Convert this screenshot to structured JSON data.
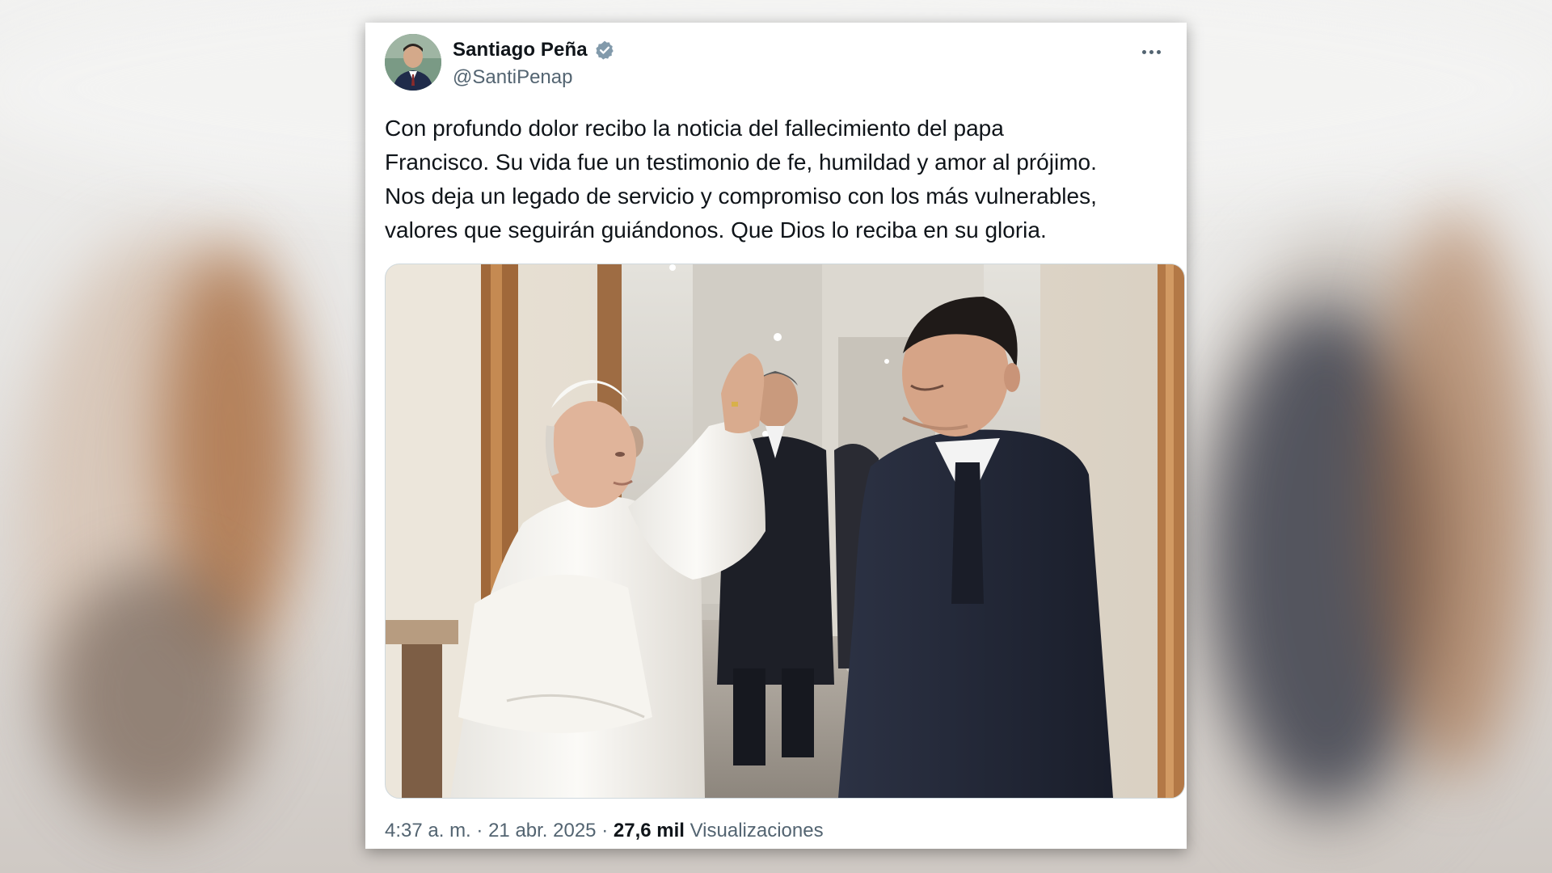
{
  "tweet": {
    "author": {
      "name": "Santiago Peña",
      "handle": "@SantiPenap",
      "verified": true
    },
    "text_lines": [
      "Con profundo dolor recibo la noticia del fallecimiento del papa",
      "Francisco. Su vida fue un testimonio de fe, humildad y amor al prójimo.",
      "Nos deja un legado de servicio y compromiso con los más vulnerables,",
      "valores que seguirán guiándonos. Que Dios lo reciba en su gloria."
    ],
    "meta": {
      "time": "4:37 a. m.",
      "separator": "·",
      "date": "21 abr. 2025",
      "views_count": "27,6 mil",
      "views_label": "Visualizaciones"
    }
  },
  "icons": {
    "verified": "verified-badge-icon",
    "more": "more-options-icon"
  },
  "colors": {
    "verified_badge": "#829aab",
    "text_primary": "#0f1419",
    "text_secondary": "#536471",
    "card_background": "#ffffff"
  }
}
